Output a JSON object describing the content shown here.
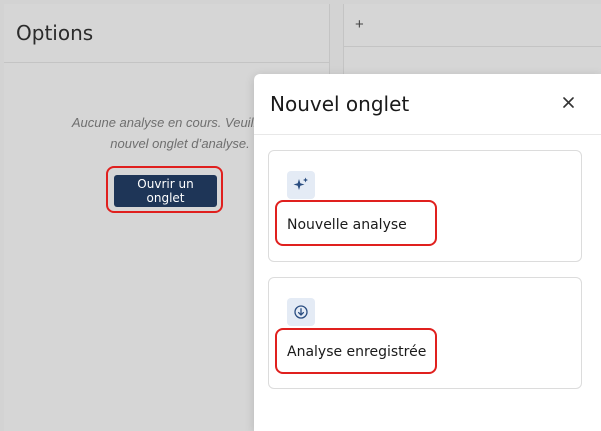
{
  "left_panel": {
    "title": "Options",
    "empty_message": "Aucune analyse en cours. Veuillez ou\nnouvel onglet d’analyse.",
    "open_button": "Ouvrir un onglet"
  },
  "right_panel": {
    "add_tab": "+"
  },
  "modal": {
    "title": "Nouvel onglet",
    "close": "×",
    "options": [
      {
        "label": "Nouvelle analyse",
        "icon": "sparkles-icon"
      },
      {
        "label": "Analyse enregistrée",
        "icon": "download-circle-icon"
      }
    ]
  },
  "colors": {
    "primary_button": "#1e3557",
    "annotation": "#e0201e",
    "icon_bg": "#e4ebf5",
    "icon_fg": "#2a4d80"
  }
}
